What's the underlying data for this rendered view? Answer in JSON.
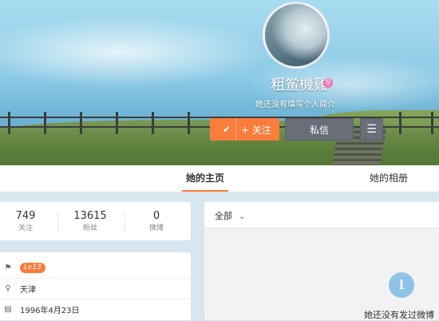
{
  "profile": {
    "username": "粗鲎機雞",
    "intro": "她还没有填写个人简介",
    "actions": {
      "follow_label": "+ 关注",
      "message_label": "私信"
    }
  },
  "tabs": [
    {
      "label": "她的主页",
      "active": true
    },
    {
      "label": "她的相册",
      "active": false
    }
  ],
  "stats": [
    {
      "value": "749",
      "label": "关注"
    },
    {
      "value": "13615",
      "label": "粉丝"
    },
    {
      "value": "0",
      "label": "微博"
    }
  ],
  "info": {
    "level": "Lv13",
    "location": "天津",
    "birthday": "1996年4月23日"
  },
  "feed": {
    "filter_label": "全部",
    "empty_text": "她还没有发过微博"
  },
  "colors": {
    "accent": "#fa7d3c",
    "button_gray": "#696e78",
    "vip_pink": "#ee76b5",
    "info_blue": "#8fc3e6"
  },
  "icons": {
    "follow_check": "check-icon",
    "menu": "hamburger-icon",
    "level": "bookmark-icon",
    "location": "location-pin-icon",
    "birthday": "cake-icon",
    "filter": "chevron-down-icon",
    "empty": "info-icon"
  }
}
